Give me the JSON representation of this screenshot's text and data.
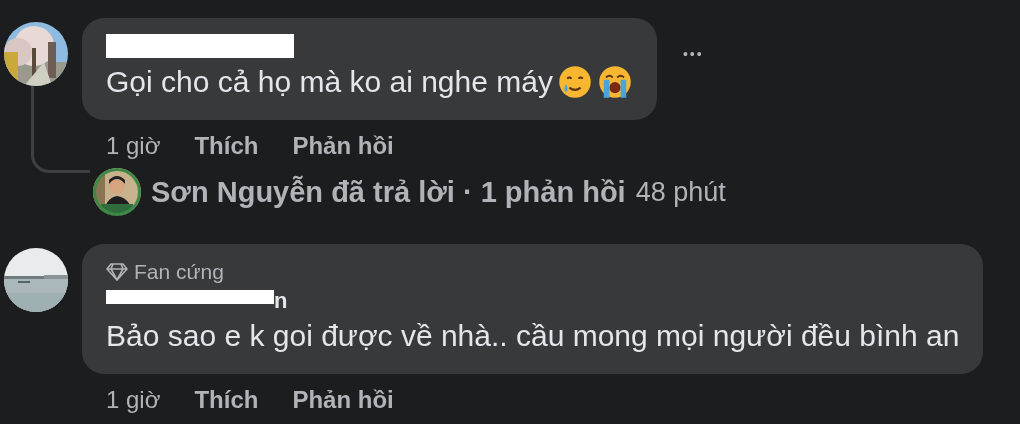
{
  "comments": [
    {
      "author": {
        "redacted": true
      },
      "text": "Gọi cho cả họ mà ko ai nghe máy",
      "emojis": [
        {
          "kind": "smiling-tear"
        },
        {
          "kind": "crying"
        }
      ],
      "more": "•••",
      "time": "1 giờ",
      "like": "Thích",
      "reply": "Phản hồi",
      "reply_summary": {
        "text": "Sơn Nguyễn đã trả lời · 1 phản hồi",
        "time": "48 phút"
      }
    },
    {
      "author": {
        "name": "n",
        "redacted": true
      },
      "badge": "Fan cứng",
      "text": "Bảo sao e k goi được về nhà.. cầu mong mọi người đều bình an",
      "time": "1 giờ",
      "like": "Thích",
      "reply": "Phản hồi"
    }
  ]
}
